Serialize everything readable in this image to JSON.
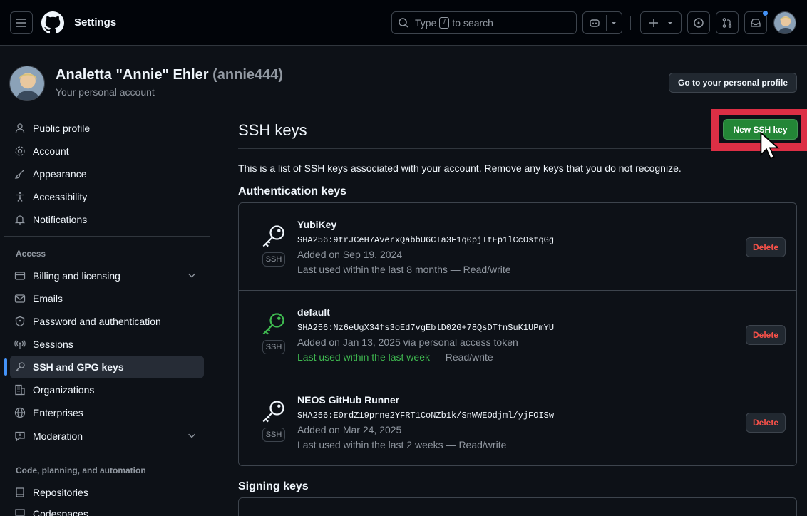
{
  "header": {
    "title": "Settings",
    "search_prefix": "Type",
    "search_key": "/",
    "search_suffix": "to search",
    "notification_dot_color": "#4493f8"
  },
  "profile": {
    "name": "Analetta \"Annie\" Ehler",
    "handle": "(annie444)",
    "subtitle": "Your personal account",
    "go_profile_label": "Go to your personal profile"
  },
  "sidebar": {
    "items_top": [
      {
        "label": "Public profile",
        "icon": "person-icon"
      },
      {
        "label": "Account",
        "icon": "gear-icon"
      },
      {
        "label": "Appearance",
        "icon": "paintbrush-icon"
      },
      {
        "label": "Accessibility",
        "icon": "accessibility-icon"
      },
      {
        "label": "Notifications",
        "icon": "bell-icon"
      }
    ],
    "access_heading": "Access",
    "items_access": [
      {
        "label": "Billing and licensing",
        "icon": "credit-card-icon"
      },
      {
        "label": "Emails",
        "icon": "mail-icon"
      },
      {
        "label": "Password and authentication",
        "icon": "shield-icon"
      },
      {
        "label": "Sessions",
        "icon": "broadcast-icon"
      },
      {
        "label": "SSH and GPG keys",
        "icon": "key-icon"
      },
      {
        "label": "Organizations",
        "icon": "organization-icon"
      },
      {
        "label": "Enterprises",
        "icon": "globe-icon"
      },
      {
        "label": "Moderation",
        "icon": "report-icon"
      }
    ],
    "code_heading": "Code, planning, and automation",
    "items_code": [
      {
        "label": "Repositories",
        "icon": "repo-icon"
      },
      {
        "label": "Codespaces",
        "icon": "codespaces-icon"
      }
    ],
    "accent_color": "#4493f8"
  },
  "main": {
    "title": "SSH keys",
    "new_key_label": "New SSH key",
    "intro": "This is a list of SSH keys associated with your account. Remove any keys that you do not recognize.",
    "auth_heading": "Authentication keys",
    "signing_heading": "Signing keys",
    "highlight_color": "#dc2f45",
    "keys": [
      {
        "name": "YubiKey",
        "fingerprint": "SHA256:9trJCeH7AverxQabbU6CIa3F1q0pjItEp1lCcOstqGg",
        "added": "Added on Sep 19, 2024",
        "used_highlight": "",
        "used": "Last used within the last 8 months — Read/write",
        "badge": "SSH",
        "delete_label": "Delete",
        "icon_color": "#f0f6fc"
      },
      {
        "name": "default",
        "fingerprint": "SHA256:Nz6eUgX34fs3oEd7vgEblD02G+78QsDTfnSuK1UPmYU",
        "added": "Added on Jan 13, 2025 via personal access token",
        "used_highlight": "Last used within the last week",
        "used": " — Read/write",
        "badge": "SSH",
        "delete_label": "Delete",
        "icon_color": "#3fb950"
      },
      {
        "name": "NEOS GitHub Runner",
        "fingerprint": "SHA256:E0rdZ19prne2YFRT1CoNZb1k/SnWWEOdjml/yjFOISw",
        "added": "Added on Mar 24, 2025",
        "used_highlight": "",
        "used": "Last used within the last 2 weeks — Read/write",
        "badge": "SSH",
        "delete_label": "Delete",
        "icon_color": "#f0f6fc"
      }
    ]
  }
}
